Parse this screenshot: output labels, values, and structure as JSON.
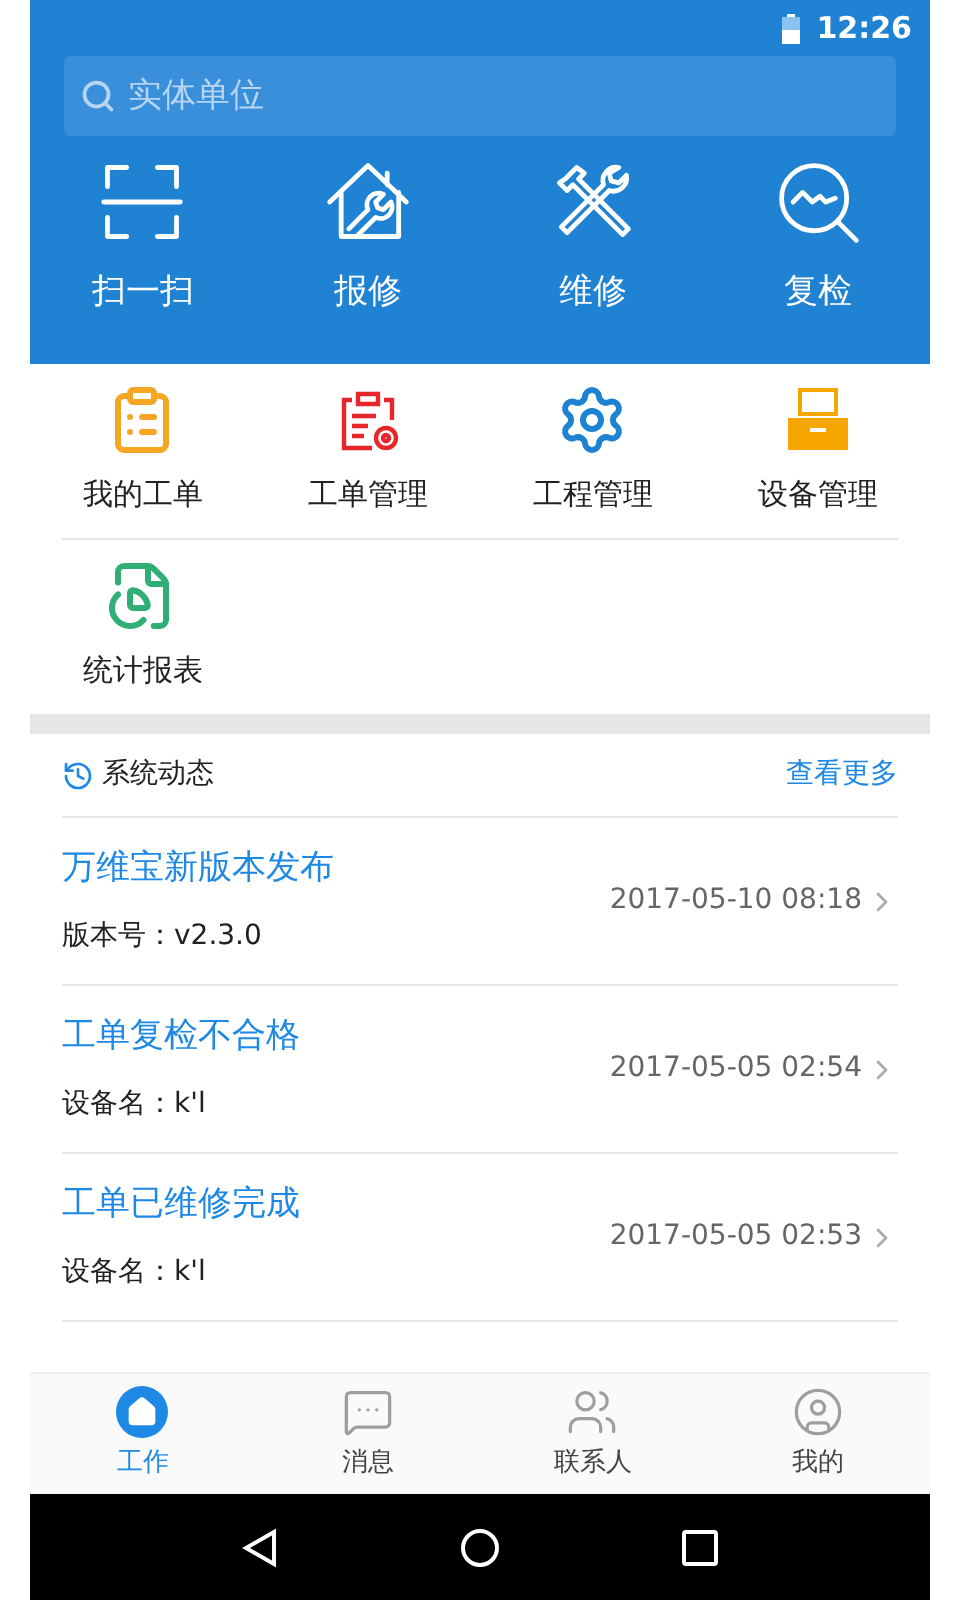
{
  "status_bar": {
    "time": "12:26"
  },
  "search": {
    "placeholder": "实体单位"
  },
  "quick_actions": [
    {
      "kind": "scan",
      "label": "扫一扫"
    },
    {
      "kind": "report",
      "label": "报修"
    },
    {
      "kind": "repair",
      "label": "维修"
    },
    {
      "kind": "recheck",
      "label": "复检"
    }
  ],
  "modules": [
    {
      "kind": "my_orders",
      "label": "我的工单",
      "color": "#f5a623"
    },
    {
      "kind": "order_manage",
      "label": "工单管理",
      "color": "#e8262a"
    },
    {
      "kind": "project_manage",
      "label": "工程管理",
      "color": "#1e82d2"
    },
    {
      "kind": "device_manage",
      "label": "设备管理",
      "color": "#f7a600"
    },
    {
      "kind": "reports",
      "label": "统计报表",
      "color": "#2fae76"
    }
  ],
  "news": {
    "title": "系统动态",
    "more": "查看更多",
    "items": [
      {
        "title": "万维宝新版本发布",
        "subtitle": "版本号：v2.3.0",
        "time": "2017-05-10 08:18"
      },
      {
        "title": "工单复检不合格",
        "subtitle": "设备名：k'l",
        "time": "2017-05-05 02:54"
      },
      {
        "title": "工单已维修完成",
        "subtitle": "设备名：k'l",
        "time": "2017-05-05 02:53"
      }
    ]
  },
  "tabs": [
    {
      "kind": "work",
      "label": "工作",
      "selected": true
    },
    {
      "kind": "messages",
      "label": "消息",
      "selected": false
    },
    {
      "kind": "contacts",
      "label": "联系人",
      "selected": false
    },
    {
      "kind": "me",
      "label": "我的",
      "selected": false
    }
  ]
}
